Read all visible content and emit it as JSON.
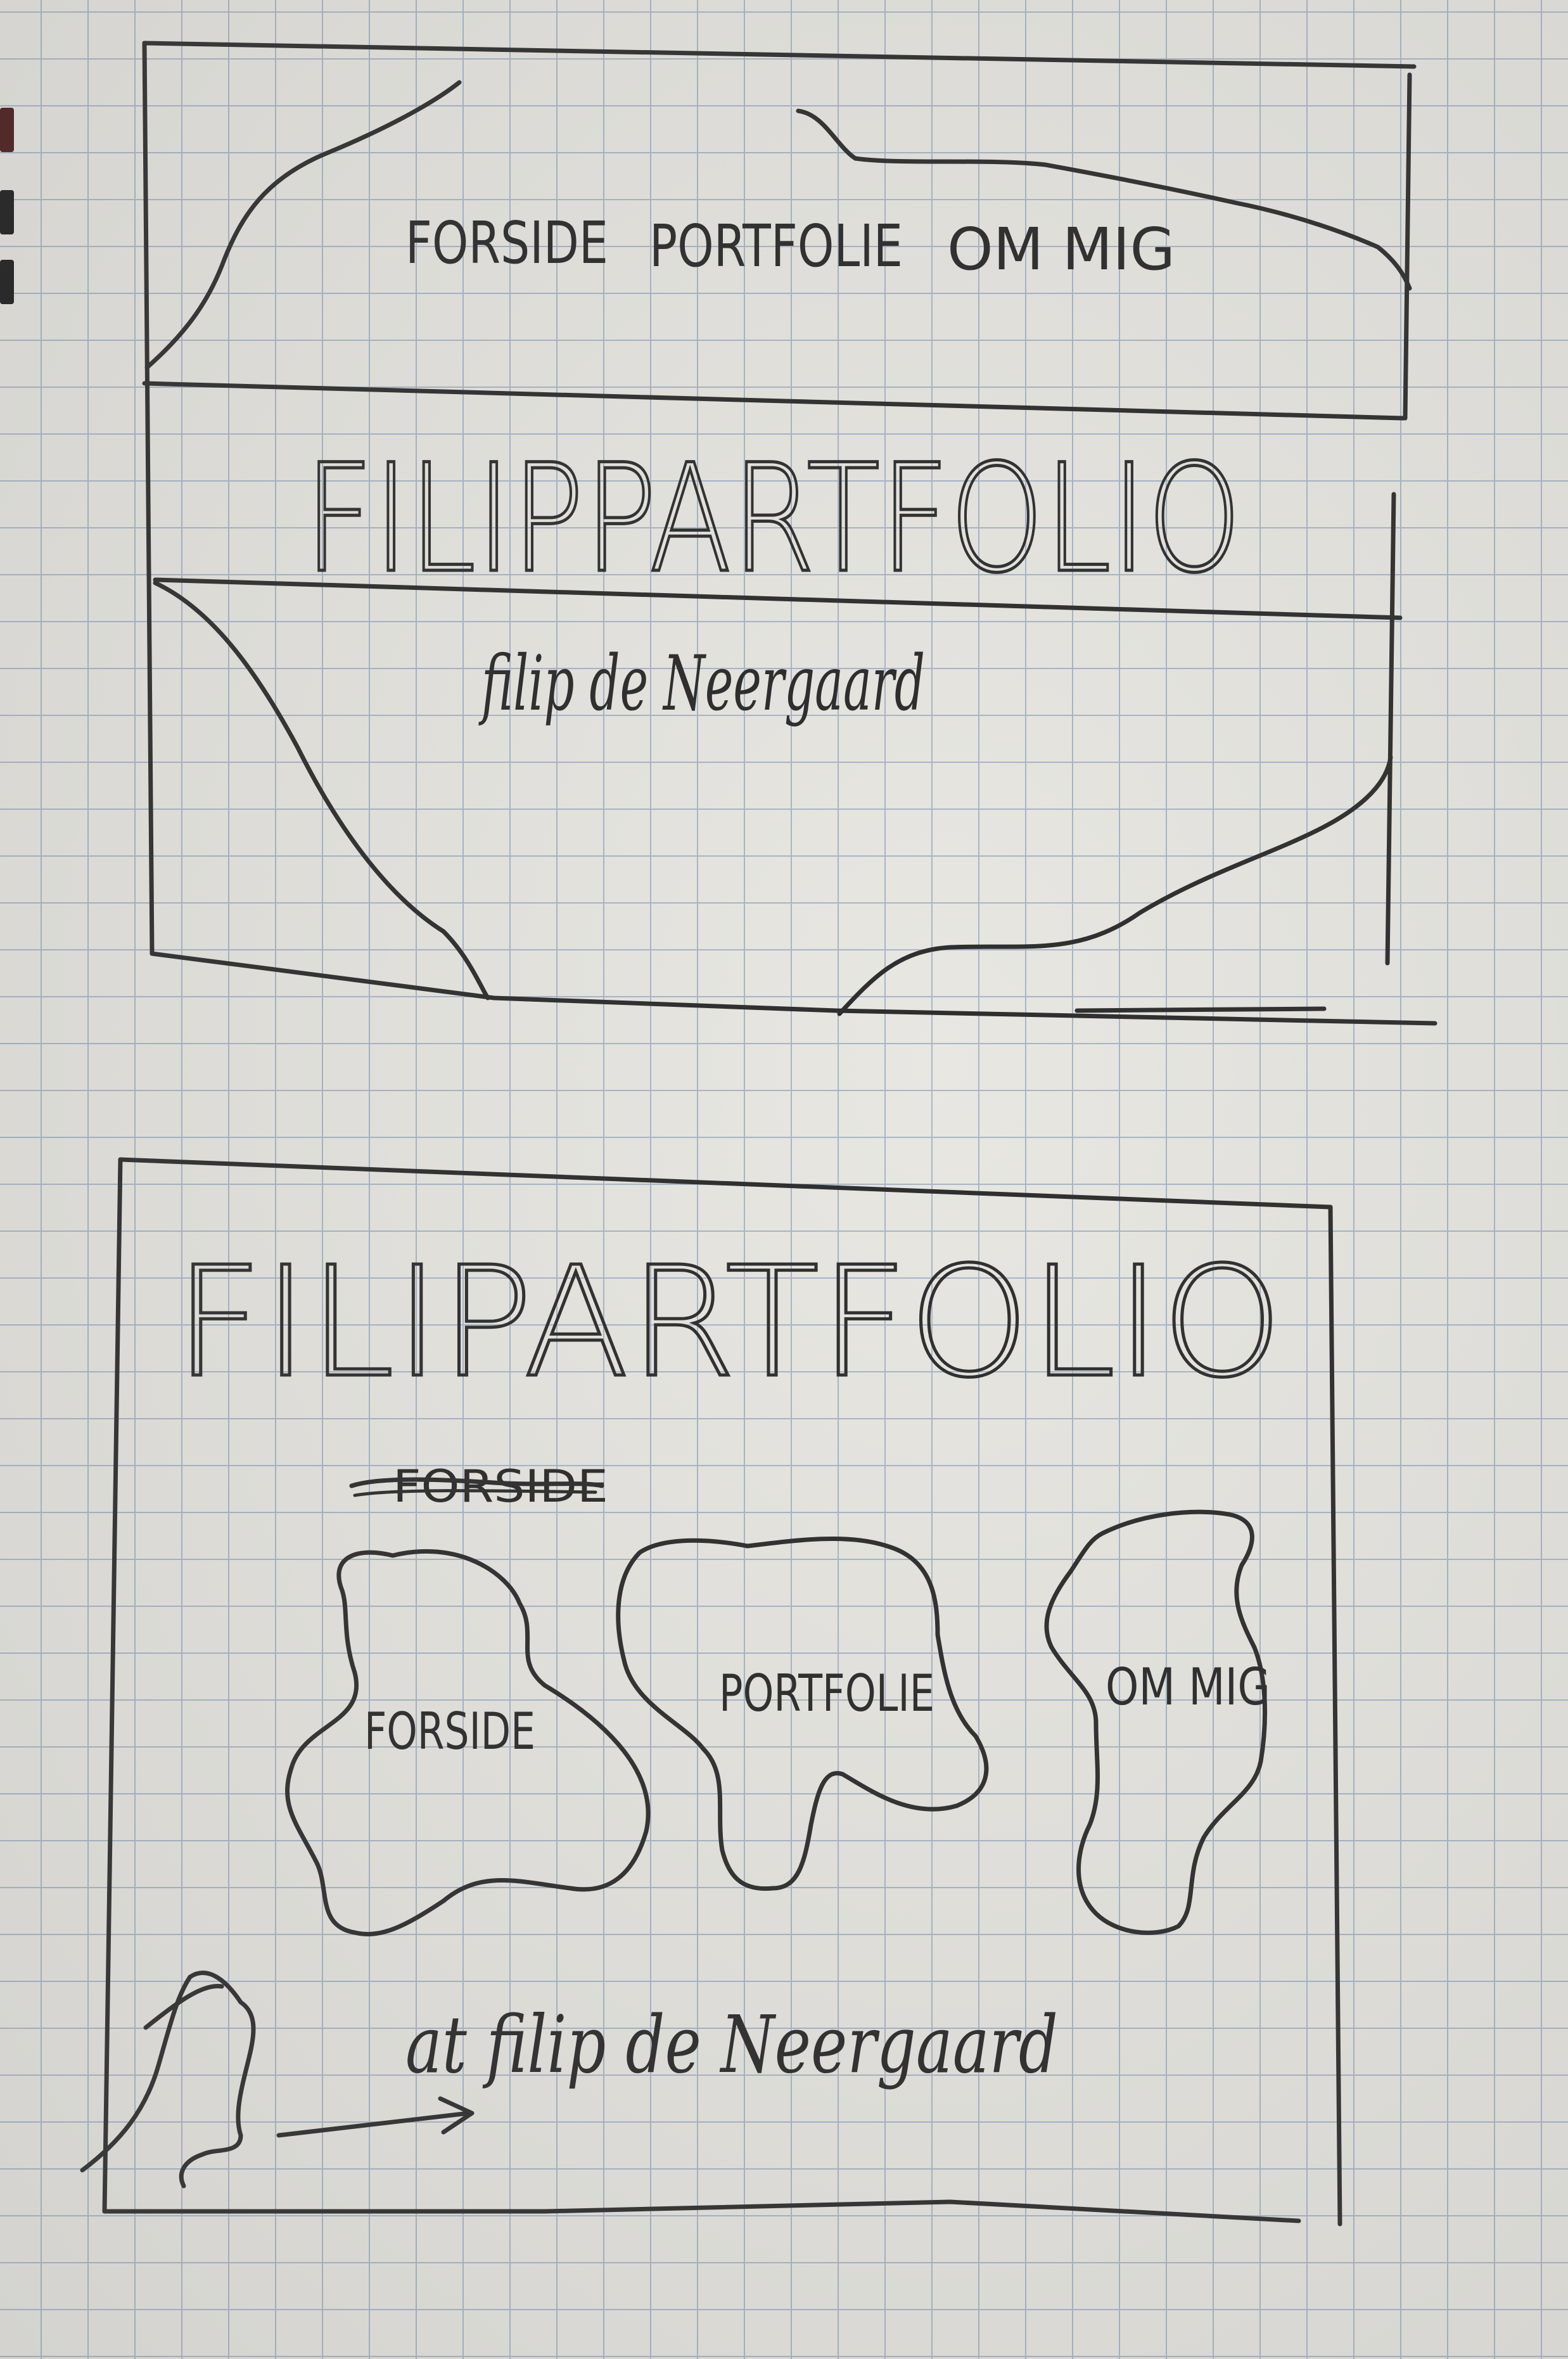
{
  "sketch1": {
    "nav_items": [
      "FORSIDE",
      "PORTFOLIE",
      "OM MIG"
    ],
    "title": "FILIPPARTFOLIO",
    "author": "filip de Neergaard"
  },
  "sketch2": {
    "title": "FILIPARTFOLIO",
    "struck_label": "FORSIDE",
    "blob_labels": [
      "FORSIDE",
      "PORTFOLIE",
      "OM MIG"
    ],
    "footer": "at filip de Neergaard"
  }
}
